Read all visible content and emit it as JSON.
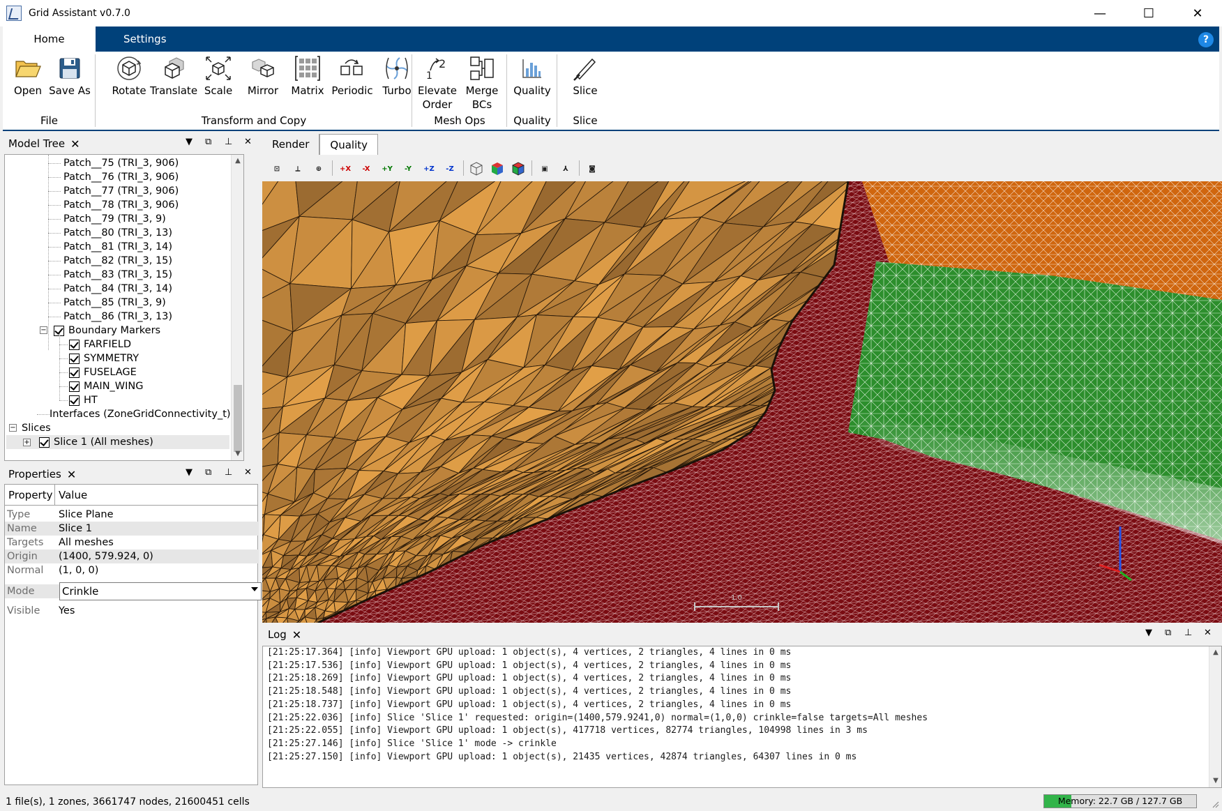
{
  "window": {
    "title": "Grid Assistant  v0.7.0",
    "controls": [
      "—",
      "☐",
      "✕"
    ]
  },
  "ribbon": {
    "tabs": [
      {
        "label": "Home",
        "active": true
      },
      {
        "label": "Settings",
        "active": false
      }
    ],
    "help": "?",
    "groups": [
      {
        "title": "File",
        "buttons": [
          {
            "label": "Open",
            "icon": "folder-open-icon"
          },
          {
            "label": "Save As",
            "icon": "floppy-disk-icon"
          }
        ]
      },
      {
        "title": "Transform and Copy",
        "buttons": [
          {
            "label": "Rotate",
            "icon": "rotate-cube-icon"
          },
          {
            "label": "Translate",
            "icon": "translate-cube-icon"
          },
          {
            "label": "Scale",
            "icon": "scale-cube-icon"
          },
          {
            "label": "Mirror",
            "icon": "mirror-cube-icon"
          },
          {
            "label": "Matrix",
            "icon": "matrix-grid-icon"
          },
          {
            "label": "Periodic",
            "icon": "periodic-icon"
          },
          {
            "label": "Turbo",
            "icon": "turbo-fan-icon"
          }
        ]
      },
      {
        "title": "Mesh Ops",
        "buttons": [
          {
            "label": "Elevate Order",
            "line1": "Elevate",
            "line2": "Order",
            "icon": "elevate-order-icon"
          },
          {
            "label": "Merge BCs",
            "line1": "Merge",
            "line2": "BCs",
            "icon": "merge-bcs-icon"
          }
        ]
      },
      {
        "title": "Quality",
        "buttons": [
          {
            "label": "Quality",
            "icon": "bar-chart-icon"
          }
        ]
      },
      {
        "title": "Slice",
        "buttons": [
          {
            "label": "Slice",
            "icon": "knife-icon"
          }
        ]
      }
    ]
  },
  "model_tree": {
    "title": "Model Tree",
    "patches": [
      "Patch__75 (TRI_3, 906)",
      "Patch__76 (TRI_3, 906)",
      "Patch__77 (TRI_3, 906)",
      "Patch__78 (TRI_3, 906)",
      "Patch__79 (TRI_3, 9)",
      "Patch__80 (TRI_3, 13)",
      "Patch__81 (TRI_3, 14)",
      "Patch__82 (TRI_3, 15)",
      "Patch__83 (TRI_3, 15)",
      "Patch__84 (TRI_3, 14)",
      "Patch__85 (TRI_3, 9)",
      "Patch__86 (TRI_3, 13)"
    ],
    "boundary_markers": {
      "label": "Boundary Markers",
      "items": [
        "FARFIELD",
        "SYMMETRY",
        "FUSELAGE",
        "MAIN_WING",
        "HT"
      ]
    },
    "interfaces": "Interfaces (ZoneGridConnectivity_t)",
    "slices": {
      "label": "Slices",
      "items": [
        "Slice 1  (All meshes)"
      ]
    }
  },
  "properties": {
    "title": "Properties",
    "columns": [
      "Property",
      "Value"
    ],
    "rows": [
      {
        "key": "Type",
        "value": "Slice Plane"
      },
      {
        "key": "Name",
        "value": "Slice 1"
      },
      {
        "key": "Targets",
        "value": "All meshes"
      },
      {
        "key": "Origin",
        "value": "(1400, 579.924, 0)"
      },
      {
        "key": "Normal",
        "value": "(1, 0, 0)"
      },
      {
        "key": "Mode",
        "value": "Crinkle"
      },
      {
        "key": "Visible",
        "value": "Yes"
      }
    ]
  },
  "viewer": {
    "tabs": [
      "Render",
      "Quality"
    ],
    "active_tab": "Quality",
    "toolbar": [
      {
        "name": "fit-view-icon",
        "glyph": "⊡"
      },
      {
        "name": "axes-reset-icon",
        "glyph": "⟂"
      },
      {
        "name": "zoom-icon",
        "glyph": "⊕"
      },
      {
        "name": "view-plus-x-icon",
        "glyph": "+X"
      },
      {
        "name": "view-minus-x-icon",
        "glyph": "-X"
      },
      {
        "name": "view-plus-y-icon",
        "glyph": "+Y"
      },
      {
        "name": "view-minus-y-icon",
        "glyph": "-Y"
      },
      {
        "name": "view-plus-z-icon",
        "glyph": "+Z"
      },
      {
        "name": "view-minus-z-icon",
        "glyph": "-Z"
      },
      {
        "name": "wireframe-icon",
        "glyph": ""
      },
      {
        "name": "shaded-icon",
        "glyph": ""
      },
      {
        "name": "shaded-edges-icon",
        "glyph": ""
      },
      {
        "name": "bounding-box-icon",
        "glyph": "▣"
      },
      {
        "name": "orientation-axes-icon",
        "glyph": "⅄"
      },
      {
        "name": "screenshot-icon",
        "glyph": "◙"
      }
    ],
    "colors": {
      "volume": "#e3a048",
      "volume_dark": "#7a5226",
      "farfield": "#d0660e",
      "symmetry": "#2c8e2c",
      "fuselage": "#7a0b11",
      "edge": "#ffffff"
    },
    "scale_bar_label": "1.0"
  },
  "log": {
    "title": "Log",
    "lines": [
      "[21:25:17.364] [info] Viewport GPU upload: 1 object(s), 4 vertices, 2 triangles, 4 lines in 0 ms",
      "[21:25:17.536] [info] Viewport GPU upload: 1 object(s), 4 vertices, 2 triangles, 4 lines in 0 ms",
      "[21:25:18.269] [info] Viewport GPU upload: 1 object(s), 4 vertices, 2 triangles, 4 lines in 0 ms",
      "[21:25:18.548] [info] Viewport GPU upload: 1 object(s), 4 vertices, 2 triangles, 4 lines in 0 ms",
      "[21:25:18.737] [info] Viewport GPU upload: 1 object(s), 4 vertices, 2 triangles, 4 lines in 0 ms",
      "[21:25:22.036] [info] Slice 'Slice 1' requested: origin=(1400,579.9241,0) normal=(1,0,0) crinkle=false targets=All meshes",
      "[21:25:22.055] [info] Viewport GPU upload: 1 object(s), 417718 vertices, 82774 triangles, 104998 lines in 3 ms",
      "[21:25:27.146] [info] Slice 'Slice 1' mode -> crinkle",
      "[21:25:27.150] [info] Viewport GPU upload: 1 object(s), 21435 vertices, 42874 triangles, 64307 lines in 0 ms"
    ]
  },
  "status": {
    "summary": "1 file(s), 1 zones, 3661747 nodes, 21600451 cells",
    "memory_text": "Memory: 22.7 GB / 127.7 GB",
    "memory_fraction": 0.178,
    "memory_color": "#32b44a"
  }
}
